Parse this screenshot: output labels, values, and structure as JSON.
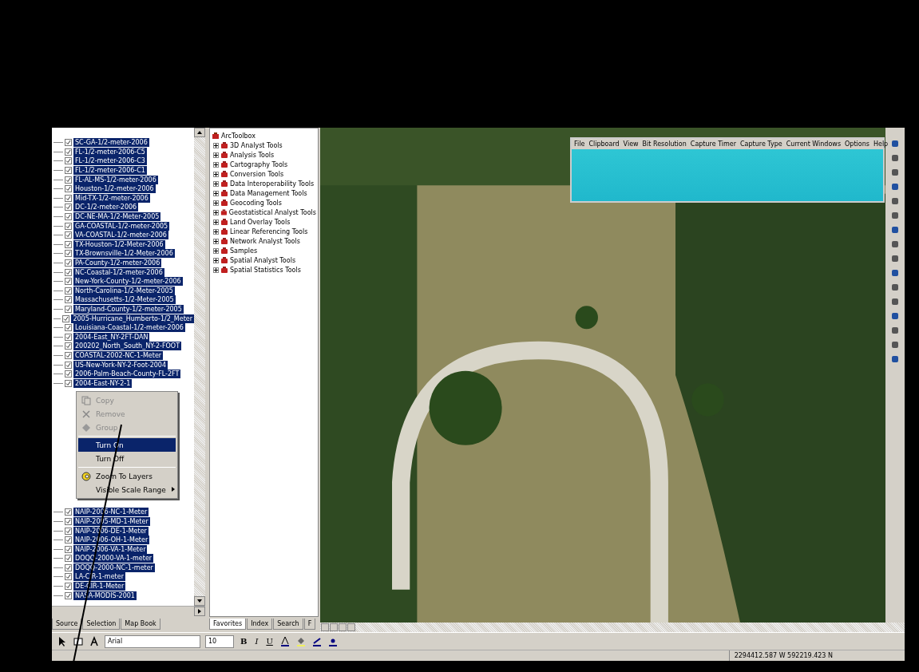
{
  "table_of_contents": {
    "layers_top": [
      {
        "name": "SC-GA-1/2-meter-2006",
        "checked": true,
        "selected": true
      },
      {
        "name": "FL-1/2-meter-2006-C5",
        "checked": true,
        "selected": true
      },
      {
        "name": "FL-1/2-meter-2006-C3",
        "checked": true,
        "selected": true
      },
      {
        "name": "FL-1/2-meter-2006-C1",
        "checked": true,
        "selected": true
      },
      {
        "name": "FL-AL-MS-1/2-meter-2006",
        "checked": true,
        "selected": true
      },
      {
        "name": "Houston-1/2-meter-2006",
        "checked": true,
        "selected": true
      },
      {
        "name": "Mid-TX-1/2-meter-2006",
        "checked": true,
        "selected": true
      },
      {
        "name": "DC-1/2-meter-2006",
        "checked": true,
        "selected": true
      },
      {
        "name": "DC-NE-MA-1/2-Meter-2005",
        "checked": true,
        "selected": true
      },
      {
        "name": "GA-COASTAL-1/2-meter-2005",
        "checked": true,
        "selected": true
      },
      {
        "name": "VA-COASTAL-1/2-meter-2006",
        "checked": true,
        "selected": true
      },
      {
        "name": "TX-Houston-1/2-Meter-2006",
        "checked": true,
        "selected": true
      },
      {
        "name": "TX-Brownsville-1/2-Meter-2006",
        "checked": true,
        "selected": true
      },
      {
        "name": "PA-County-1/2-meter-2006",
        "checked": true,
        "selected": true
      },
      {
        "name": "NC-Coastal-1/2-meter-2006",
        "checked": true,
        "selected": true
      },
      {
        "name": "New-York-County-1/2-meter-2006",
        "checked": true,
        "selected": true
      },
      {
        "name": "North-Carolina-1/2-Meter-2005",
        "checked": true,
        "selected": true
      },
      {
        "name": "Massachusetts-1/2-Meter-2005",
        "checked": true,
        "selected": true
      },
      {
        "name": "Maryland-County-1/2-meter-2005",
        "checked": true,
        "selected": true
      },
      {
        "name": "2005-Hurricane_Humberto-1/2_Meter",
        "checked": true,
        "selected": true
      },
      {
        "name": "Louisiana-Coastal-1/2-meter-2006",
        "checked": true,
        "selected": true
      },
      {
        "name": "2004-East_NY-2FT-DAN",
        "checked": true,
        "selected": true
      },
      {
        "name": "200202_North_South_NY-2-FOOT",
        "checked": true,
        "selected": true
      },
      {
        "name": "COASTAL-2002-NC-1-Meter",
        "checked": true,
        "selected": true
      },
      {
        "name": "US-New-York-NY-2-Foot-2004",
        "checked": true,
        "selected": true
      },
      {
        "name": "2006-Palm-Beach-County-FL-2FT",
        "checked": true,
        "selected": true
      },
      {
        "name": "2004-East-NY-2-1",
        "checked": true,
        "selected": true
      }
    ],
    "layers_bottom": [
      {
        "name": "NAIP-2006-NC-1-Meter",
        "checked": true,
        "selected": true
      },
      {
        "name": "NAIP-2005-MD-1-Meter",
        "checked": true,
        "selected": true
      },
      {
        "name": "NAIP-2006-DE-1-Meter",
        "checked": true,
        "selected": true
      },
      {
        "name": "NAIP-2006-OH-1-Meter",
        "checked": true,
        "selected": true
      },
      {
        "name": "NAIP-2006-VA-1-Meter",
        "checked": true,
        "selected": true
      },
      {
        "name": "DOQQ-2000-VA-1-meter",
        "checked": true,
        "selected": true
      },
      {
        "name": "DOQQ-2000-NC-1-meter",
        "checked": true,
        "selected": true
      },
      {
        "name": "LA-CIR-1-meter",
        "checked": true,
        "selected": true
      },
      {
        "name": "DE-CIR-1-Meter",
        "checked": true,
        "selected": true
      },
      {
        "name": "NASA-MODIS-2001",
        "checked": true,
        "selected": true
      }
    ],
    "tabs": [
      {
        "label": "Source",
        "selected": false
      },
      {
        "label": "Selection",
        "selected": false
      },
      {
        "label": "Map Book",
        "selected": false
      }
    ]
  },
  "context_menu": {
    "items": [
      {
        "kind": "item",
        "label": "Copy",
        "disabled": true,
        "selected": false
      },
      {
        "kind": "item",
        "label": "Remove",
        "disabled": true,
        "selected": false
      },
      {
        "kind": "item",
        "label": "Group",
        "disabled": true,
        "selected": false
      },
      {
        "kind": "separator"
      },
      {
        "kind": "item",
        "label": "Turn On",
        "disabled": false,
        "selected": true
      },
      {
        "kind": "item",
        "label": "Turn Off",
        "disabled": false,
        "selected": false
      },
      {
        "kind": "separator"
      },
      {
        "kind": "item",
        "label": "Zoom To Layers",
        "disabled": false,
        "selected": false
      },
      {
        "kind": "submenu",
        "label": "Visible Scale Range",
        "disabled": false,
        "selected": false
      }
    ]
  },
  "toolbox": {
    "root": "ArcToolbox",
    "items": [
      "3D Analyst Tools",
      "Analysis Tools",
      "Cartography Tools",
      "Conversion Tools",
      "Data Interoperability Tools",
      "Data Management Tools",
      "Geocoding Tools",
      "Geostatistical Analyst Tools",
      "Land Overlay Tools",
      "Linear Referencing Tools",
      "Network Analyst Tools",
      "Samples",
      "Spatial Analyst Tools",
      "Spatial Statistics Tools"
    ],
    "tabs": [
      {
        "label": "Favorites",
        "selected": true
      },
      {
        "label": "Index",
        "selected": false
      },
      {
        "label": "Search",
        "selected": false
      },
      {
        "label": "F",
        "selected": false
      }
    ]
  },
  "capture_window": {
    "menu": [
      "File",
      "Clipboard",
      "View",
      "Bit Resolution",
      "Capture Timer",
      "Capture Type",
      "Current Windows",
      "Options",
      "Help"
    ]
  },
  "draw_toolbar": {
    "font": "Arial",
    "size": "10",
    "styles": [
      "B",
      "I",
      "U"
    ]
  },
  "status_bar": {
    "coordinates": "2294412.587 W  592219.423 N"
  }
}
